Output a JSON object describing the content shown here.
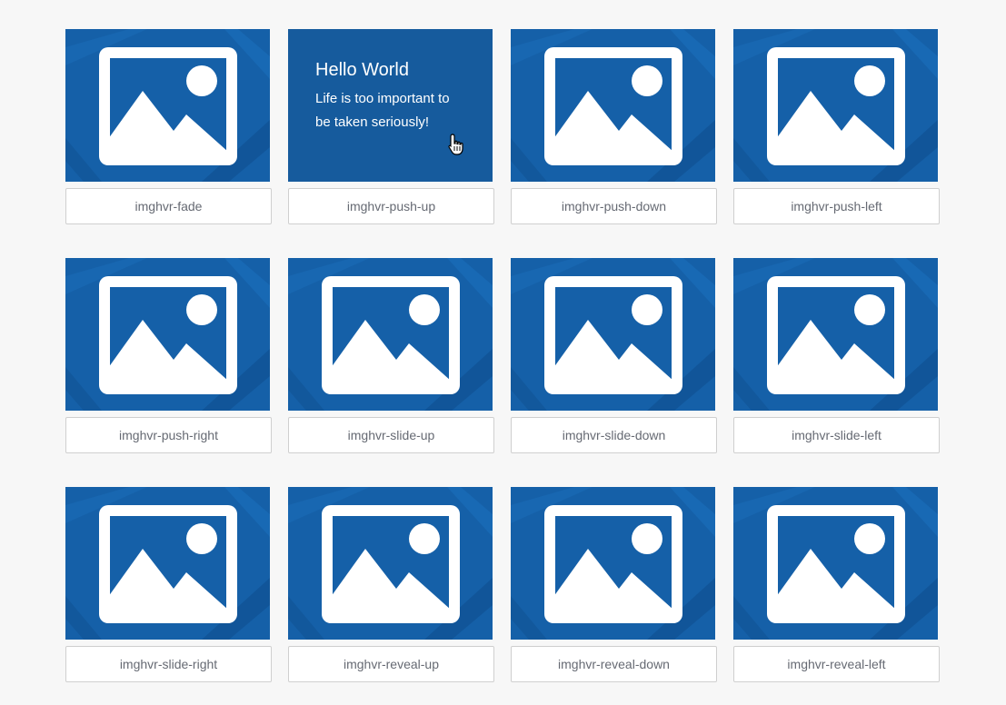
{
  "hover_caption": {
    "title": "Hello World",
    "text": "Life is too important to be taken seriously!"
  },
  "demos": [
    {
      "label": "imghvr-fade"
    },
    {
      "label": "imghvr-push-up"
    },
    {
      "label": "imghvr-push-down"
    },
    {
      "label": "imghvr-push-left"
    },
    {
      "label": "imghvr-push-right"
    },
    {
      "label": "imghvr-slide-up"
    },
    {
      "label": "imghvr-slide-down"
    },
    {
      "label": "imghvr-slide-left"
    },
    {
      "label": "imghvr-slide-right"
    },
    {
      "label": "imghvr-reveal-up"
    },
    {
      "label": "imghvr-reveal-down"
    },
    {
      "label": "imghvr-reveal-left"
    }
  ],
  "hovered_index": 1,
  "icons": {
    "thumbnail": "image-placeholder-icon",
    "cursor": "hand-pointer-icon"
  },
  "colors": {
    "thumbnail_bg": "#1560a8",
    "caption_bg": "#165b9d",
    "page_bg": "#f7f7f7"
  }
}
